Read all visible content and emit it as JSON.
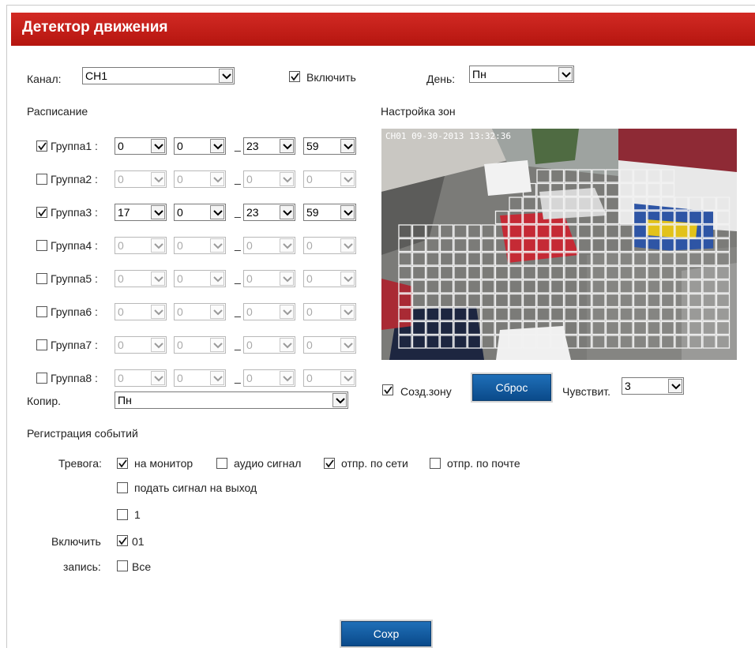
{
  "header": {
    "title": "Детектор движения"
  },
  "channel": {
    "label": "Канал:",
    "value": "CH1"
  },
  "enable": {
    "label": "Включить",
    "checked": true
  },
  "day": {
    "label": "День:",
    "value": "Пн"
  },
  "schedule": {
    "title": "Расписание",
    "groups": [
      {
        "label": "Группа1 :",
        "checked": true,
        "start_h": "0",
        "start_m": "0",
        "end_h": "23",
        "end_m": "59"
      },
      {
        "label": "Группа2 :",
        "checked": false,
        "start_h": "0",
        "start_m": "0",
        "end_h": "0",
        "end_m": "0"
      },
      {
        "label": "Группа3 :",
        "checked": true,
        "start_h": "17",
        "start_m": "0",
        "end_h": "23",
        "end_m": "59"
      },
      {
        "label": "Группа4 :",
        "checked": false,
        "start_h": "0",
        "start_m": "0",
        "end_h": "0",
        "end_m": "0"
      },
      {
        "label": "Группа5 :",
        "checked": false,
        "start_h": "0",
        "start_m": "0",
        "end_h": "0",
        "end_m": "0"
      },
      {
        "label": "Группа6 :",
        "checked": false,
        "start_h": "0",
        "start_m": "0",
        "end_h": "0",
        "end_m": "0"
      },
      {
        "label": "Группа7 :",
        "checked": false,
        "start_h": "0",
        "start_m": "0",
        "end_h": "0",
        "end_m": "0"
      },
      {
        "label": "Группа8 :",
        "checked": false,
        "start_h": "0",
        "start_m": "0",
        "end_h": "0",
        "end_m": "0"
      }
    ],
    "separator": "_"
  },
  "copy": {
    "label": "Копир.",
    "value": "Пн"
  },
  "zones": {
    "title": "Настройка зон",
    "camera_overlay": "CH01  09-30-2013 13:32:36",
    "create_zone": {
      "label": "Созд.зону",
      "checked": true
    },
    "reset_label": "Сброс",
    "sensitivity": {
      "label": "Чувствит.",
      "value": "3"
    }
  },
  "events": {
    "title": "Регистрация событий",
    "alarm_label": "Тревога:",
    "alarm_options": [
      {
        "label": "на монитор",
        "checked": true
      },
      {
        "label": "аудио сигнал",
        "checked": false
      },
      {
        "label": "отпр. по сети",
        "checked": true
      },
      {
        "label": "отпр. по почте",
        "checked": false
      }
    ],
    "output_label": "подать сигнал на выход",
    "output_checked": false,
    "output_1_label": "1",
    "output_1_checked": false,
    "enable_label": "Включить",
    "enable_01_label": "01",
    "enable_01_checked": true,
    "record_label": "запись:",
    "record_all_label": "Все",
    "record_all_checked": false
  },
  "save_label": "Сохр",
  "colors": {
    "header": "#c41e1a",
    "button": "#0f5a9e"
  }
}
